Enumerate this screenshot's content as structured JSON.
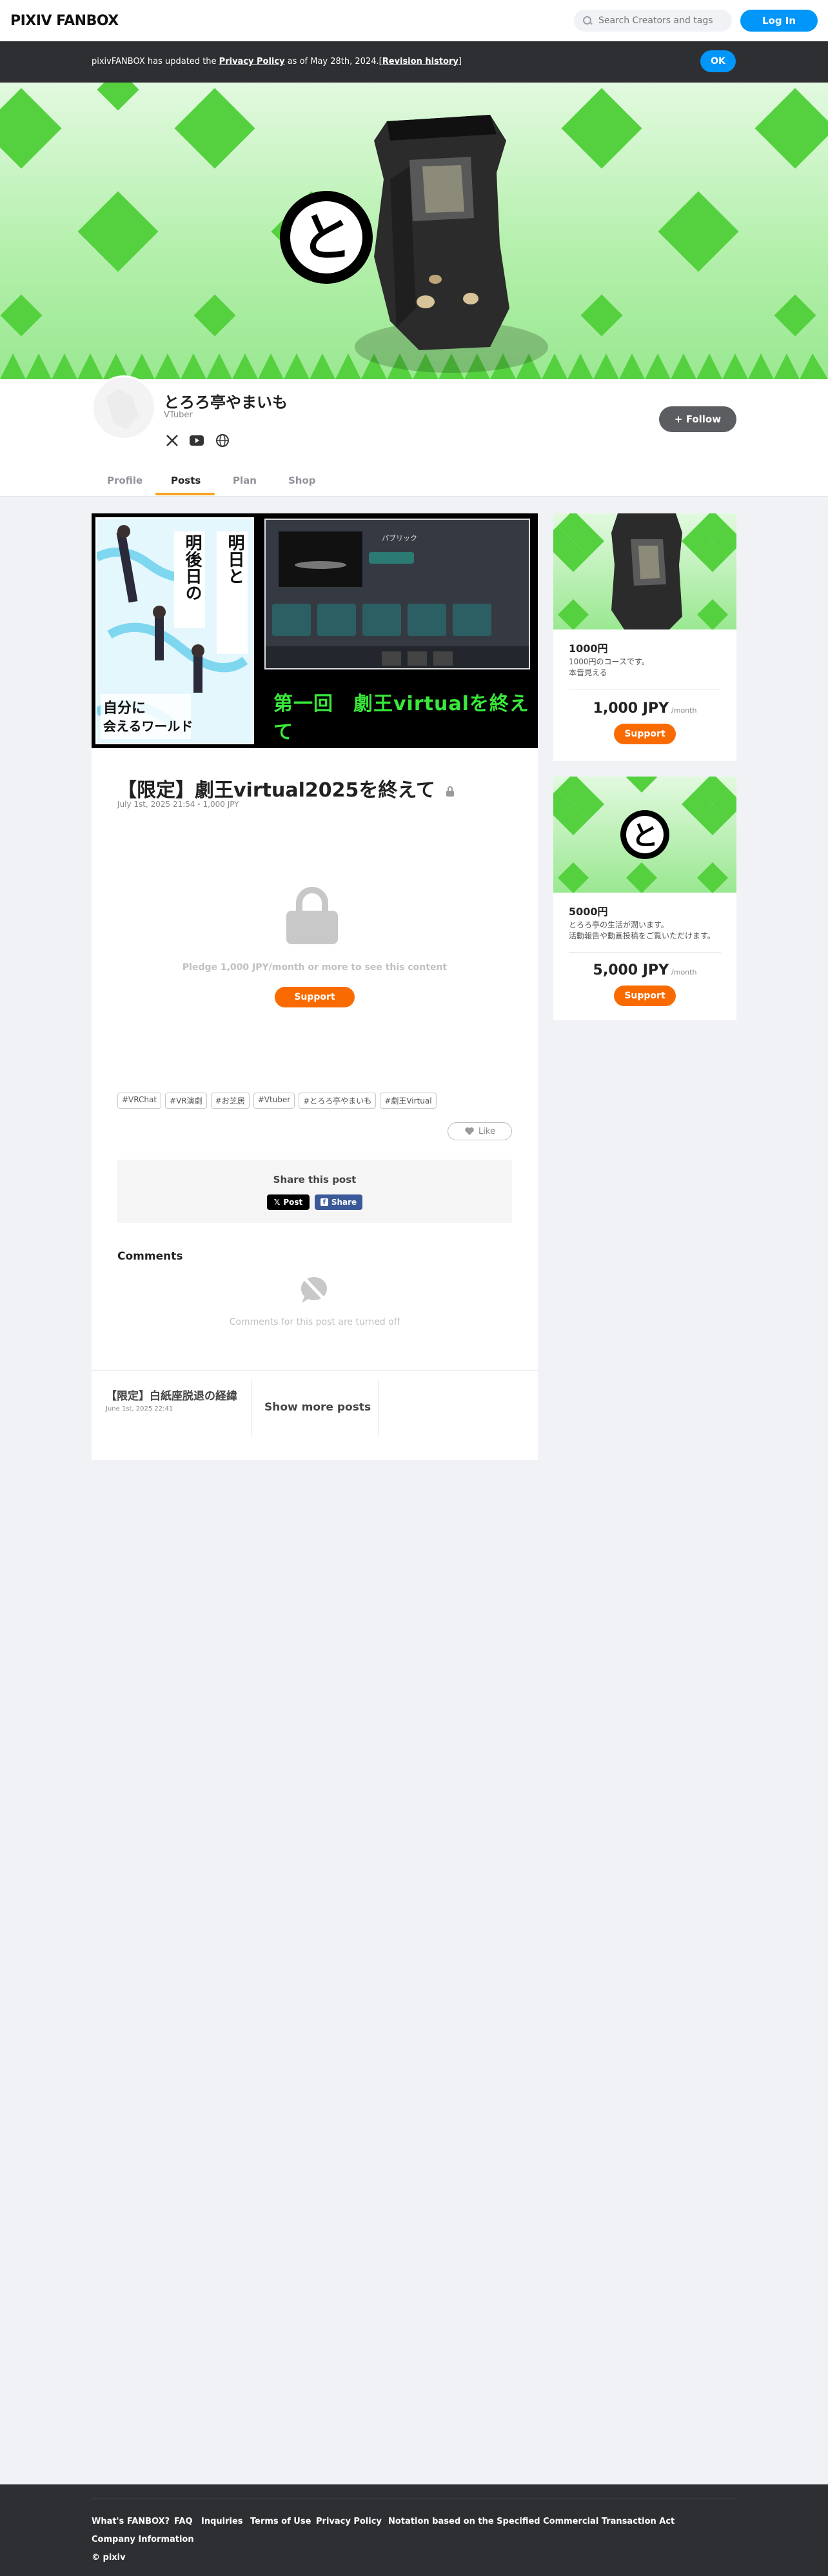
{
  "header": {
    "logo": "PIXIV FANBOX",
    "search_placeholder": "Search Creators and tags",
    "login_label": "Log In"
  },
  "notice": {
    "prefix": "pixivFANBOX has updated the ",
    "link": "Privacy Policy",
    "middle": " as of May 28th, 2024.[",
    "history": "Revision history",
    "suffix": "]",
    "ok_label": "OK"
  },
  "cover": {
    "emblem_char": "と"
  },
  "creator": {
    "name": "とろろ亭やまいも",
    "category": "VTuber",
    "follow_label": "+ Follow",
    "social_icons": [
      "x-icon",
      "youtube-icon",
      "globe-icon"
    ]
  },
  "tabs": [
    "Profile",
    "Posts",
    "Plan",
    "Shop"
  ],
  "active_tab": "Posts",
  "post": {
    "image": {
      "manga_lines": [
        "明日と",
        "明後日の",
        "自分に",
        "会えるワールド"
      ],
      "episode_title": "第一回　劇王virtualを終えて",
      "screen_header": "パブリック"
    },
    "title": "【限定】劇王virtual2025を終えて",
    "meta": "July 1st, 2025 21:54・1,000 JPY",
    "pledge_text": "Pledge 1,000 JPY/month or more to see this content",
    "support_label": "Support",
    "tags": [
      "#VRChat",
      "#VR演劇",
      "#お芝居",
      "#Vtuber",
      "#とろろ亭やまいも",
      "#劇王Virtual"
    ],
    "like_label": "Like",
    "share_title": "Share this post",
    "share_x_label": "Post",
    "share_fb_label": "Share",
    "comments_title": "Comments",
    "comments_off": "Comments for this post are turned off",
    "prev_post_title": "【限定】白紙座脱退の経緯",
    "prev_post_date": "June 1st, 2025 22:41",
    "more_posts_label": "Show more posts"
  },
  "plans": [
    {
      "name": "1000円",
      "desc": [
        "1000円のコースです。",
        "本音見える"
      ],
      "price": "1,000 JPY",
      "per": "/month",
      "support_label": "Support"
    },
    {
      "name": "5000円",
      "desc": [
        "とろろ亭の生活が潤います。",
        "活動報告や動画投稿をご覧いただけます。"
      ],
      "price": "5,000 JPY",
      "per": "/month",
      "support_label": "Support"
    }
  ],
  "footer": {
    "links": [
      "What's FANBOX?",
      "FAQ",
      "Inquiries",
      "Terms of Use",
      "Privacy Policy",
      "Notation based on the Specified Commercial Transaction Act"
    ],
    "company_info": "Company Information",
    "copyright": "© pixiv"
  },
  "colors": {
    "accent_blue": "#0096fa",
    "support_orange": "#f96b00",
    "tab_underline": "#f5a623",
    "cover_green": "#55d13f",
    "dark": "#2e2f33"
  }
}
